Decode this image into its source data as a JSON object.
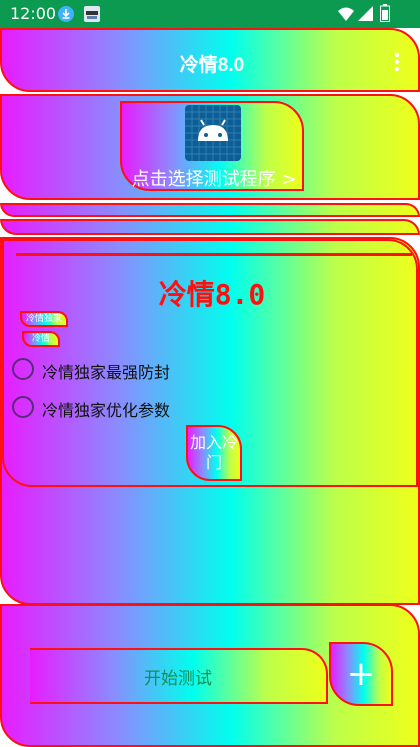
{
  "status_bar": {
    "time": "12:00",
    "icons": [
      "download-icon",
      "app-notification-icon",
      "wifi-icon",
      "signal-icon",
      "battery-icon"
    ]
  },
  "app_bar": {
    "title": "冷情8.0",
    "menu_icon": "more-vertical-icon"
  },
  "selector": {
    "icon": "android-icon",
    "label": "点击选择测试程序 >"
  },
  "main": {
    "headline": "冷情8.0",
    "chip1": "冷情独家",
    "chip2": "冷情",
    "options": [
      {
        "label": "冷情独家最强防封"
      },
      {
        "label": "冷情独家优化参数"
      }
    ],
    "join_button": "加入冷门"
  },
  "bottom": {
    "start_label": "开始测试",
    "fab_icon": "plus-icon",
    "fab_label": "+"
  },
  "colors": {
    "status_bar": "#0b9a4f",
    "border": "#ff1010",
    "headline": "#ff1010",
    "start_text": "#188c5a",
    "gradient": [
      "#e81cff",
      "#8a8cff",
      "#00ffee",
      "#bcff4a",
      "#eeff1a"
    ]
  }
}
